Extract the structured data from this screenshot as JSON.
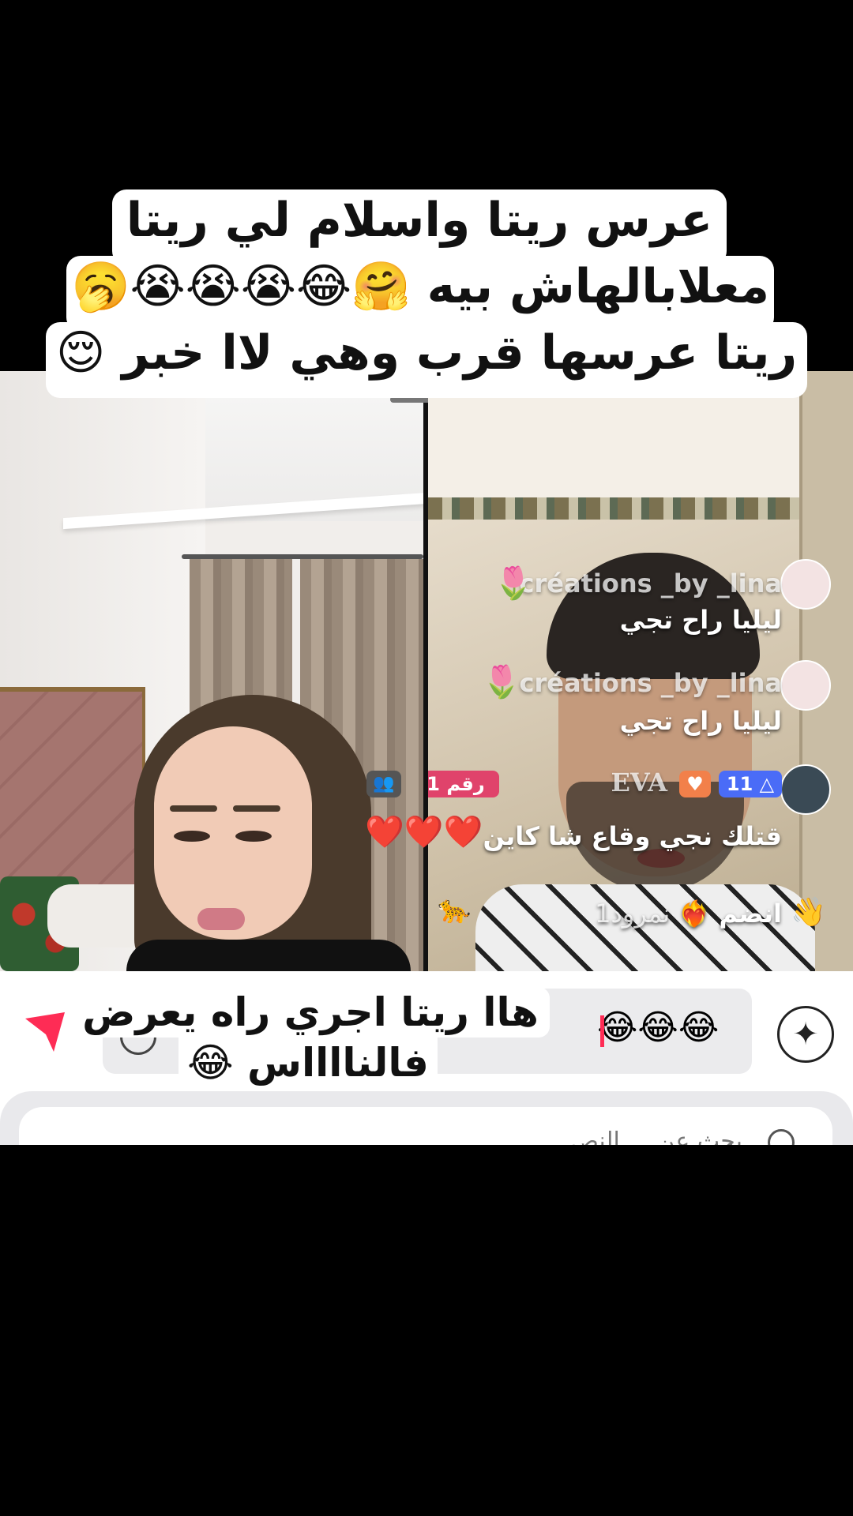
{
  "caption": {
    "line1": "عرس ريتا واسلام لي ريتا",
    "line2": "معلابالهاش بيه 🤗😂😭😭😭🥱",
    "line3": "ريتا عرسها قرب وهي لاا خبر 😌"
  },
  "live_chat": {
    "messages": [
      {
        "user": "créations _by _lina",
        "text": "ليليا راح تجي",
        "emoji": "🌷"
      },
      {
        "user": "créations _by _lina",
        "text": "ليليا راح تجي",
        "emoji": "🌷"
      },
      {
        "user": "EVA",
        "text": "قتلك نجي وقاع شا كاين",
        "emoji": "❤️❤️❤️",
        "level": "11",
        "rank": "رقم 1"
      }
    ],
    "join_text": "انضم",
    "join_user": "نمرود1"
  },
  "reply_caption": {
    "line1": "هاا ريتا اجري راه يعرض",
    "line2": "فالنااااس 😂"
  },
  "comment_box": {
    "emojis": "😂😂😂"
  },
  "search": {
    "placeholder": "بحث عن ... النص"
  },
  "icons": {
    "send": "send-icon",
    "sparkle": "ai-sparkle-icon",
    "search": "search-icon"
  },
  "colors": {
    "accent": "#fe2c55",
    "level_badge": "#4a6cf7",
    "rank_badge": "#e0436b"
  }
}
